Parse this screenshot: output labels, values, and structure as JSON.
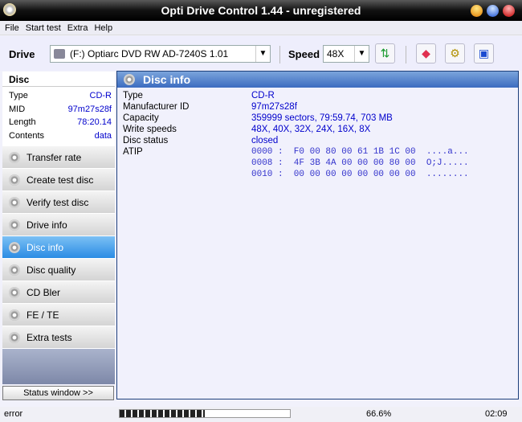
{
  "window": {
    "title": "Opti Drive Control 1.44 - unregistered"
  },
  "menu": [
    "File",
    "Start test",
    "Extra",
    "Help"
  ],
  "toolbar": {
    "drive_label": "Drive",
    "drive_value": "(F:)  Optiarc DVD RW AD-7240S 1.01",
    "speed_label": "Speed",
    "speed_value": "48X"
  },
  "left": {
    "title": "Disc",
    "info": [
      {
        "k": "Type",
        "v": "CD-R"
      },
      {
        "k": "MID",
        "v": "97m27s28f"
      },
      {
        "k": "Length",
        "v": "78:20.14"
      },
      {
        "k": "Contents",
        "v": "data"
      }
    ],
    "nav": [
      "Transfer rate",
      "Create test disc",
      "Verify test disc",
      "Drive info",
      "Disc info",
      "Disc quality",
      "CD Bler",
      "FE / TE",
      "Extra tests"
    ],
    "active": "Disc info",
    "status_button": "Status window >>"
  },
  "main": {
    "title": "Disc info",
    "rows": [
      {
        "k": "Type",
        "v": "CD-R"
      },
      {
        "k": "Manufacturer ID",
        "v": "97m27s28f"
      },
      {
        "k": "Capacity",
        "v": "359999 sectors, 79:59.74, 703 MB"
      },
      {
        "k": "Write speeds",
        "v": "48X, 40X, 32X, 24X, 16X, 8X"
      },
      {
        "k": "Disc status",
        "v": "closed"
      },
      {
        "k": "ATIP",
        "v": ""
      }
    ],
    "atip": [
      "0000 :  F0 00 80 00 61 1B 1C 00  ....a...",
      "0008 :  4F 3B 4A 00 00 00 80 00  O;J.....",
      "0010 :  00 00 00 00 00 00 00 00  ........"
    ]
  },
  "status": {
    "text": "error",
    "progress_percent": 66.6,
    "progress_label": "66.6%",
    "time": "02:09"
  }
}
